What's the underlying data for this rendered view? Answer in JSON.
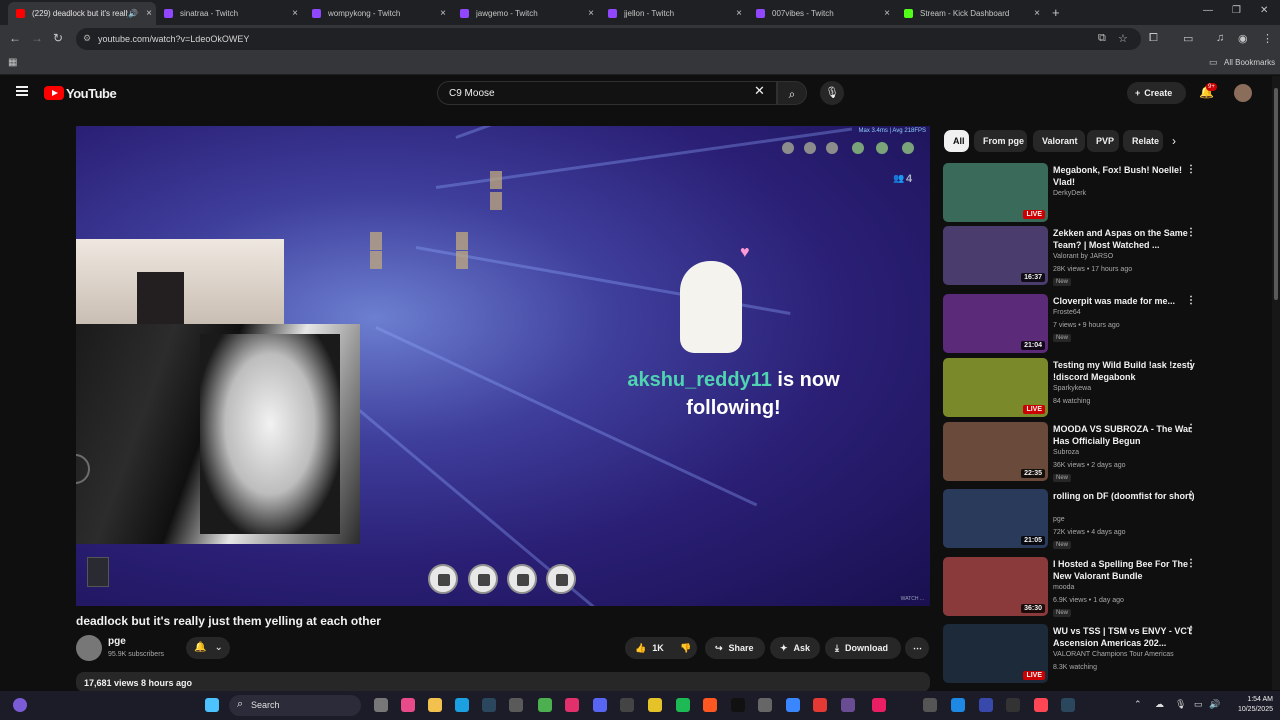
{
  "browser": {
    "tabs": [
      {
        "title": "(229) deadlock but it's really",
        "active": true,
        "favicon_color": "#ff0000"
      },
      {
        "title": "sinatraa - Twitch",
        "favicon_color": "#9146ff"
      },
      {
        "title": "wompykong - Twitch",
        "favicon_color": "#9146ff"
      },
      {
        "title": "jawgemo - Twitch",
        "favicon_color": "#9146ff"
      },
      {
        "title": "jjellon - Twitch",
        "favicon_color": "#9146ff"
      },
      {
        "title": "007vibes - Twitch",
        "favicon_color": "#9146ff"
      },
      {
        "title": "Stream - Kick Dashboard",
        "favicon_color": "#53fc18"
      }
    ],
    "url": "youtube.com/watch?v=LdeoOkOWEY",
    "bookmarks_label": "All Bookmarks"
  },
  "youtube": {
    "logo": "YouTube",
    "search_value": "C9 Moose",
    "create_label": "Create",
    "notif_badge": "9+",
    "video": {
      "title": "deadlock but it's really just them yelling at each other",
      "channel": "pge",
      "subscribers": "95.9K subscribers",
      "likes": "1K",
      "share": "Share",
      "ask": "Ask",
      "download": "Download",
      "views_date": "17,681 views  8 hours ago",
      "overlay_user": "akshu_reddy11",
      "overlay_rest": " is now",
      "overlay_line2": "following!",
      "hud_top": "Max  3.4ms | Avg  218FPS",
      "hud_count": "4",
      "hud_bottom": "WATCH ..."
    },
    "chips": [
      "All",
      "From pge",
      "Valorant",
      "PVP",
      "Relate"
    ],
    "recommendations": [
      {
        "title": "Megabonk, Fox! Bush! Noelle! Vlad!",
        "channel": "DerkyDerk",
        "meta": "",
        "badge": "LIVE",
        "is_new": false,
        "thumb": "#3a6a5a"
      },
      {
        "title": "Zekken and Aspas on the Same Team? | Most Watched ...",
        "channel": "Valorant by JARSO",
        "meta": "28K views • 17 hours ago",
        "badge": "16:37",
        "is_new": true,
        "thumb": "#4a3c6c"
      },
      {
        "title": "Cloverpit was made for me...",
        "channel": "Froste64",
        "meta": "7 views • 9 hours ago",
        "badge": "21:04",
        "is_new": true,
        "thumb": "#5b2b7a"
      },
      {
        "title": "Testing my Wild Build !ask !zesty !discord Megabonk",
        "channel": "Sparkykewa",
        "meta": "84 watching",
        "badge": "LIVE",
        "is_new": false,
        "thumb": "#7a8a2a"
      },
      {
        "title": "MOODA VS SUBROZA - The War Has Officially Begun",
        "channel": "Subroza",
        "meta": "36K views • 2 days ago",
        "badge": "22:35",
        "is_new": true,
        "thumb": "#6a4a3a"
      },
      {
        "title": "rolling on DF (doomfist for short)",
        "channel": "pge",
        "meta": "72K views • 4 days ago",
        "badge": "21:05",
        "is_new": true,
        "thumb": "#2a3a5a"
      },
      {
        "title": "I Hosted a Spelling Bee For The New Valorant Bundle",
        "channel": "mooda",
        "meta": "6.9K views • 1 day ago",
        "badge": "36:30",
        "is_new": true,
        "thumb": "#8a3a3a"
      },
      {
        "title": "WU vs TSS | TSM vs ENVY - VCT Ascension Americas 202...",
        "channel": "VALORANT Champions Tour Americas",
        "meta": "8.3K watching",
        "badge": "LIVE",
        "is_new": false,
        "thumb": "#1d2a3a"
      }
    ]
  },
  "taskbar": {
    "search_label": "Search",
    "time": "1:54 AM",
    "date": "10/25/2025"
  }
}
